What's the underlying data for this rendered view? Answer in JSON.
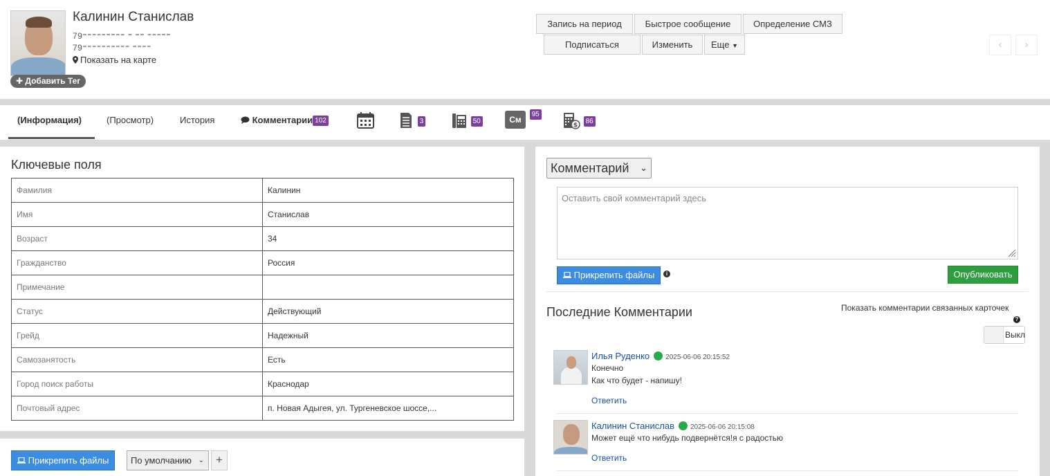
{
  "header": {
    "name": "Калинин Станислав",
    "phone1": "79⁼⁼⁼⁼⁼⁼⁼⁼⁼ ⁼ ⁼⁼ ⁼⁼⁼⁼⁼",
    "phone2": "79⁼⁼⁼⁼⁼⁼⁼⁼⁼⁼ ⁼⁼⁼⁼",
    "map_link": "Показать на карте",
    "add_tag": "Добавить Тег",
    "buttons": {
      "record_period": "Запись на период",
      "quick_message": "Быстрое сообщение",
      "smz": "Определение СМЗ",
      "subscribe": "Подписаться",
      "edit": "Изменить",
      "more": "Еще"
    }
  },
  "tabs": [
    {
      "label": "(Информация)"
    },
    {
      "label": "(Просмотр)"
    },
    {
      "label": "История"
    },
    {
      "label": "Комментарии",
      "badge": "102"
    }
  ],
  "tab_badges": {
    "docs": "3",
    "phones": "50",
    "cm_label": "См",
    "cm": "95",
    "finance": "86"
  },
  "key_fields": {
    "title": "Ключевые поля",
    "rows": [
      {
        "k": "Фамилия",
        "v": "Калинин"
      },
      {
        "k": "Имя",
        "v": "Станислав"
      },
      {
        "k": "Возраст",
        "v": "34"
      },
      {
        "k": "Гражданство",
        "v": "Россия"
      },
      {
        "k": "Примечание",
        "v": ""
      },
      {
        "k": "Статус",
        "v": "Действующий"
      },
      {
        "k": "Грейд",
        "v": "Надежный"
      },
      {
        "k": "Самозанятость",
        "v": "Есть"
      },
      {
        "k": "Город поиск работы",
        "v": "Краснодар"
      },
      {
        "k": "Почтовый адрес",
        "v": "п. Новая Адыгея, ул. Тургеневское шоссе,..."
      }
    ]
  },
  "left_bottom": {
    "attach": "Прикрепить файлы",
    "select_value": "По умолчанию",
    "plus": "+"
  },
  "comments_panel": {
    "select_label": "Комментарий",
    "placeholder": "Оставить свой комментарий здесь",
    "attach": "Прикрепить файлы",
    "publish": "Опубликовать",
    "latest_title": "Последние Комментарии",
    "related_label": "Показать комментарии связанных карточек",
    "toggle_label": "Выкл",
    "reply": "Ответить",
    "items": [
      {
        "author": "Илья Руденко",
        "time": "2025-06-06 20:15:52",
        "lines": [
          "Конечно",
          "Как что будет - напишу!"
        ]
      },
      {
        "author": "Калинин Станислав",
        "time": "2025-06-06 20:15:08",
        "lines": [
          "Может ещё что нибудь подвернётся!я с радостью"
        ]
      }
    ]
  },
  "colors": {
    "accent_blue": "#3c8ddf",
    "publish_green": "#2e9e3e",
    "badge_purple": "#7b3fa0",
    "link_blue": "#1a4fa0"
  }
}
